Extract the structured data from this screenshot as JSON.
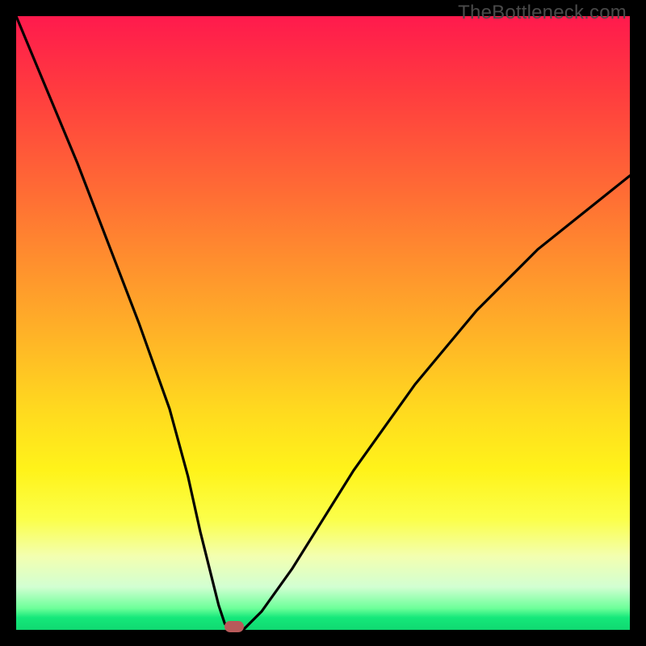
{
  "watermark": "TheBottleneck.com",
  "colors": {
    "curve_stroke": "#000000",
    "marker_fill": "#b85a5a",
    "frame_bg": "#000000"
  },
  "chart_data": {
    "type": "line",
    "title": "",
    "xlabel": "",
    "ylabel": "",
    "xlim": [
      0,
      100
    ],
    "ylim": [
      0,
      100
    ],
    "grid": false,
    "series": [
      {
        "name": "bottleneck-curve",
        "x": [
          0,
          5,
          10,
          15,
          20,
          25,
          28,
          30,
          32,
          33,
          34,
          35,
          36,
          37,
          38,
          40,
          45,
          50,
          55,
          60,
          65,
          70,
          75,
          80,
          85,
          90,
          95,
          100
        ],
        "y": [
          100,
          88,
          76,
          63,
          50,
          36,
          25,
          16,
          8,
          4,
          1,
          0,
          0,
          0,
          1,
          3,
          10,
          18,
          26,
          33,
          40,
          46,
          52,
          57,
          62,
          66,
          70,
          74
        ]
      }
    ],
    "marker": {
      "x": 35.5,
      "y": 0.5
    },
    "gradient_stops": [
      {
        "pct": 0,
        "color": "#ff1a4d"
      },
      {
        "pct": 28,
        "color": "#ff6a35"
      },
      {
        "pct": 64,
        "color": "#ffd91f"
      },
      {
        "pct": 88,
        "color": "#f3ffb0"
      },
      {
        "pct": 100,
        "color": "#10d871"
      }
    ]
  }
}
